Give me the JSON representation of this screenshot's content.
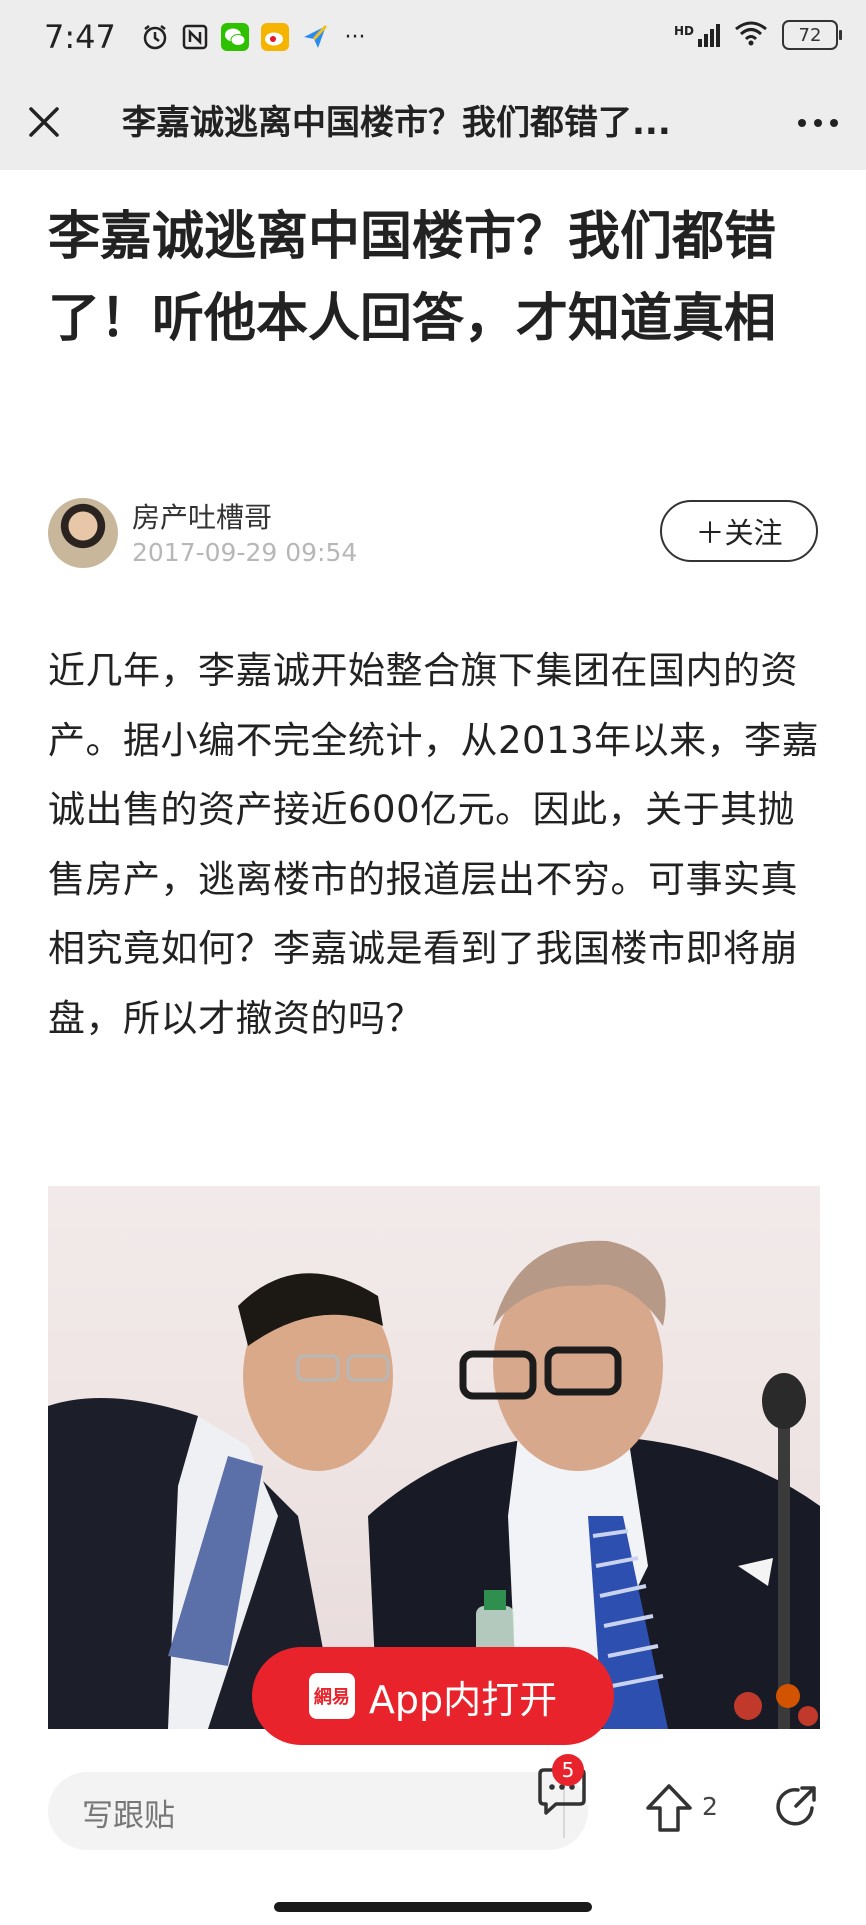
{
  "status_bar": {
    "time": "7:47",
    "battery": "72",
    "icons": [
      "alarm-icon",
      "nfc-icon",
      "wechat-icon",
      "weibo-icon",
      "app-icon",
      "more-dots-icon",
      "hd-signal-icon",
      "wifi-icon",
      "battery-icon"
    ],
    "more": "···",
    "hd": "HD"
  },
  "nav": {
    "title": "李嘉诚逃离中国楼市？我们都错了..."
  },
  "article": {
    "title": "李嘉诚逃离中国楼市？我们都错了！听他本人回答，才知道真相",
    "author": "房产吐槽哥",
    "date": "2017-09-29 09:54",
    "follow_label": "＋关注",
    "body": "近几年，李嘉诚开始整合旗下集团在国内的资产。据小编不完全统计，从2013年以来，李嘉诚出售的资产接近600亿元。因此，关于其抛售房产，逃离楼市的报道层出不穷。可事实真相究竟如何？李嘉诚是看到了我国楼市即将崩盘，所以才撤资的吗？"
  },
  "open_app": {
    "logo_text": "網易",
    "label": "App内打开"
  },
  "bottom_bar": {
    "comment_placeholder": "写跟贴",
    "comment_badge": "5",
    "up_count": "2"
  },
  "colors": {
    "accent": "#e8232b",
    "bar_bg": "#ededed"
  }
}
